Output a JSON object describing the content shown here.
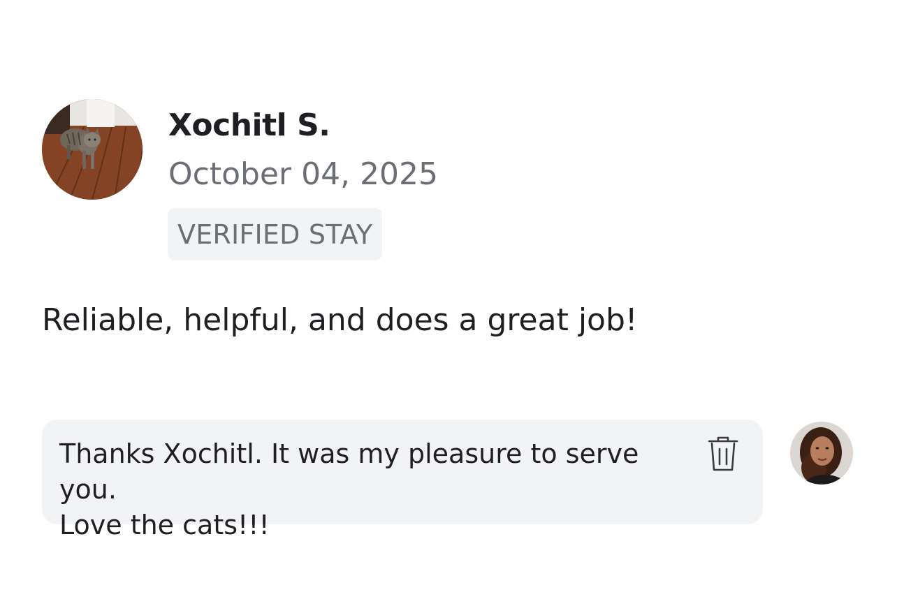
{
  "review": {
    "reviewer_name": "Xochitl S.",
    "date": "October 04, 2025",
    "badge": "VERIFIED STAY",
    "text": "Reliable, helpful, and does a great job!"
  },
  "reply": {
    "text": "Thanks Xochitl. It was my pleasure to serve you.\nLove the cats!!!",
    "delete_icon": "trash-icon"
  },
  "avatars": {
    "reviewer": "reviewer-avatar (cat on wooden floor)",
    "host": "host-avatar (woman portrait)"
  },
  "colors": {
    "text_primary": "#1f1f23",
    "text_secondary": "#6b6e75",
    "surface": "#f2f3f5"
  }
}
